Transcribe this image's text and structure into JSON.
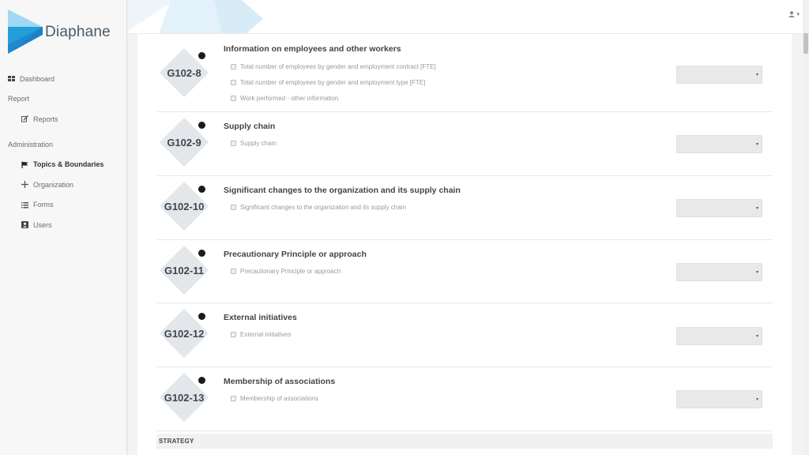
{
  "app": {
    "name": "Diaphane"
  },
  "sidebar": {
    "items": [
      {
        "label": "Dashboard",
        "icon": "grid-icon",
        "type": "top"
      },
      {
        "label": "Report",
        "type": "section"
      },
      {
        "label": "Reports",
        "icon": "edit-icon",
        "type": "sub"
      },
      {
        "label": "Administration",
        "type": "section"
      },
      {
        "label": "Topics & Boundaries",
        "icon": "flag-icon",
        "type": "sub",
        "active": true
      },
      {
        "label": "Organization",
        "icon": "move-icon",
        "type": "sub"
      },
      {
        "label": "Forms",
        "icon": "list-icon",
        "type": "sub"
      },
      {
        "label": "Users",
        "icon": "user-box-icon",
        "type": "sub"
      }
    ]
  },
  "header": {
    "user_icon": "user-icon",
    "caret": "▾"
  },
  "topics": [
    {
      "code": "G102-8",
      "title": "Information on employees and other workers",
      "options": [
        "Total number of employees by gender and employment contract [FTE]",
        "Total number of employees by gender and employment type [FTE]",
        "Work performed - other information"
      ]
    },
    {
      "code": "G102-9",
      "title": "Supply chain",
      "options": [
        "Supply chain"
      ]
    },
    {
      "code": "G102-10",
      "title": "Significant changes to the organization and its supply chain",
      "options": [
        "Significant changes to the organization and its supply chain"
      ]
    },
    {
      "code": "G102-11",
      "title": "Precautionary Principle or approach",
      "options": [
        "Precautionary Principle or approach"
      ]
    },
    {
      "code": "G102-12",
      "title": "External initiatives",
      "options": [
        "External initiatives"
      ]
    },
    {
      "code": "G102-13",
      "title": "Membership of associations",
      "options": [
        "Membership of associations"
      ]
    }
  ],
  "select_caret": "▾",
  "section_next": "STRATEGY",
  "colors": {
    "accent": "#29a8e0",
    "badge": "#e4e7ea",
    "dot": "#1b1b1b"
  }
}
